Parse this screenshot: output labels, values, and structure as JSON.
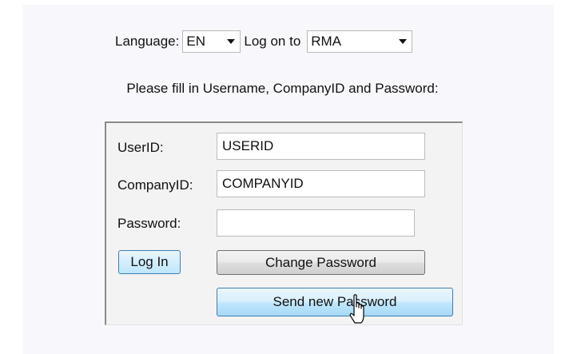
{
  "header": {
    "language_label": "Language:",
    "language_value": "EN",
    "logon_label": "Log on to",
    "logon_value": "RMA"
  },
  "instruction": "Please fill in Username, CompanyID and Password:",
  "form": {
    "userid_label": "UserID:",
    "userid_value": "USERID",
    "companyid_label": "CompanyID:",
    "companyid_value": "COMPANYID",
    "password_label": "Password:",
    "password_value": ""
  },
  "buttons": {
    "login": "Log In",
    "change_password": "Change Password",
    "send_new_password": "Send new Password"
  },
  "colors": {
    "panel_background": "#f8f8fc",
    "box_background": "#f3f3f3",
    "hover_border": "#3c7fb1",
    "hover_fill": "#bee6fd"
  },
  "icons": {
    "dropdown": "chevron-down-icon",
    "cursor": "hand-pointer-icon"
  }
}
